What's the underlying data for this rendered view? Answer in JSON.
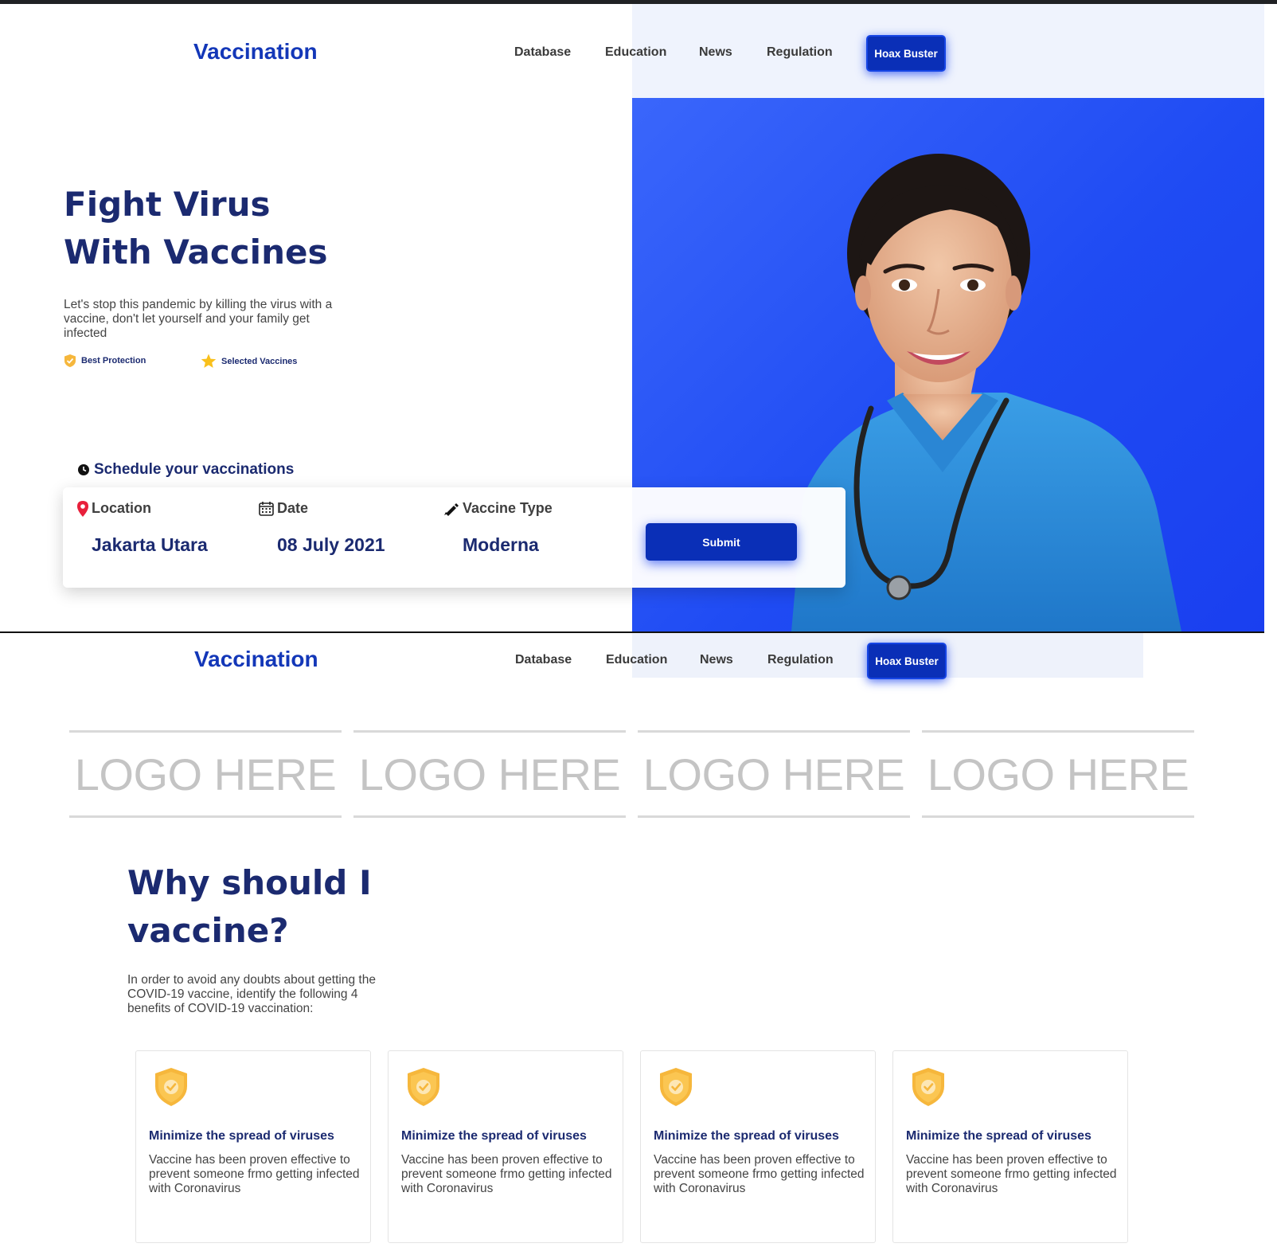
{
  "colors": {
    "brand": "#1337b8",
    "accent_blue": "#1f4bf3",
    "heading": "#1b2a70",
    "button": "#0a2fb7",
    "shield": "#f6b73c"
  },
  "screen1": {
    "brand": "Vaccination",
    "nav": [
      "Database",
      "Education",
      "News",
      "Regulation"
    ],
    "hoax_button": "Hoax Buster",
    "hero": {
      "title_line1": "Fight Virus",
      "title_line2": "With Vaccines",
      "description": "Let's stop this pandemic by killing the virus with a vaccine, don't let yourself and your family get infected",
      "features": [
        {
          "icon": "shield-icon",
          "label": "Best Protection"
        },
        {
          "icon": "star-icon",
          "label": "Selected Vaccines"
        }
      ]
    },
    "schedule": {
      "label": "Schedule your vaccinations",
      "fields": [
        {
          "icon": "location-pin-icon",
          "label": "Location",
          "value": "Jakarta Utara"
        },
        {
          "icon": "calendar-icon",
          "label": "Date",
          "value": "08 July 2021"
        },
        {
          "icon": "pen-icon",
          "label": "Vaccine Type",
          "value": "Moderna"
        }
      ],
      "submit": "Submit"
    }
  },
  "screen2": {
    "brand": "Vaccination",
    "nav": [
      "Database",
      "Education",
      "News",
      "Regulation"
    ],
    "hoax_button": "Hoax Buster",
    "logos": [
      "LOGO HERE",
      "LOGO HERE",
      "LOGO HERE",
      "LOGO HERE"
    ],
    "why": {
      "title_line1": "Why should I",
      "title_line2": "vaccine?",
      "description": "In order to avoid any doubts about getting the COVID-19 vaccine, identify the following 4 benefits of COVID-19 vaccination:"
    },
    "benefits": [
      {
        "icon": "shield-check-icon",
        "title": "Minimize the spread of viruses",
        "text": "Vaccine has been proven effective to prevent someone frmo getting infected with Coronavirus"
      },
      {
        "icon": "shield-check-icon",
        "title": "Minimize the spread of viruses",
        "text": "Vaccine has been proven effective to prevent someone frmo getting infected with Coronavirus"
      },
      {
        "icon": "shield-check-icon",
        "title": "Minimize the spread of viruses",
        "text": "Vaccine has been proven effective to prevent someone frmo getting infected with Coronavirus"
      },
      {
        "icon": "shield-check-icon",
        "title": "Minimize the spread of viruses",
        "text": "Vaccine has been proven effective to prevent someone frmo getting infected with Coronavirus"
      }
    ]
  }
}
